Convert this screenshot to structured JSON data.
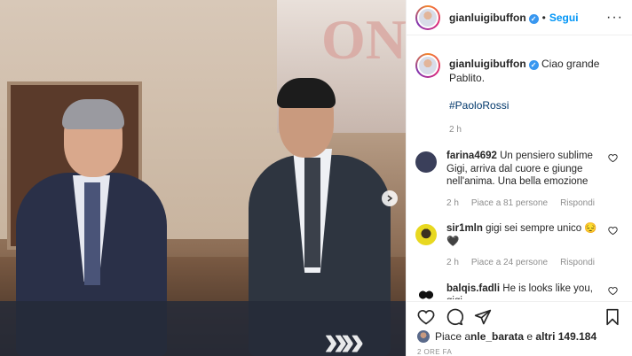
{
  "post": {
    "username": "gianluigibuffon",
    "follow_label": "Segui",
    "separator": "•",
    "more_icon": "more-horizontal-icon",
    "photo_banner_text": "ON"
  },
  "caption": {
    "username": "gianluigibuffon",
    "text": "Ciao grande Pablito.",
    "hashtag": "#PaoloRossi",
    "time": "2 h"
  },
  "comments": [
    {
      "username": "farina4692",
      "text": "Un pensiero sublime Gigi, arriva dal cuore e giunge nell'anima. Una bella emozione",
      "time": "2 h",
      "likes": "Piace a 81 persone",
      "reply": "Rispondi",
      "avatar_color": "#3a3f5a"
    },
    {
      "username": "sir1mln",
      "text": "gigi sei sempre unico 😔🖤",
      "time": "2 h",
      "likes": "Piace a 24 persone",
      "reply": "Rispondi",
      "avatar_color": "#e8d820"
    },
    {
      "username": "balqis.fadli",
      "text": "He is looks like you, gigi",
      "avatar_color": "#111111"
    }
  ],
  "likes_summary": {
    "prefix": "Piace a ",
    "user": "nle_barata",
    "middle": " e ",
    "others": "altri 149.184"
  },
  "date": "2 ORE FA",
  "colors": {
    "link": "#0095f6",
    "verified": "#3897f0",
    "muted": "#8e8e8e",
    "hashtag": "#00376b"
  }
}
